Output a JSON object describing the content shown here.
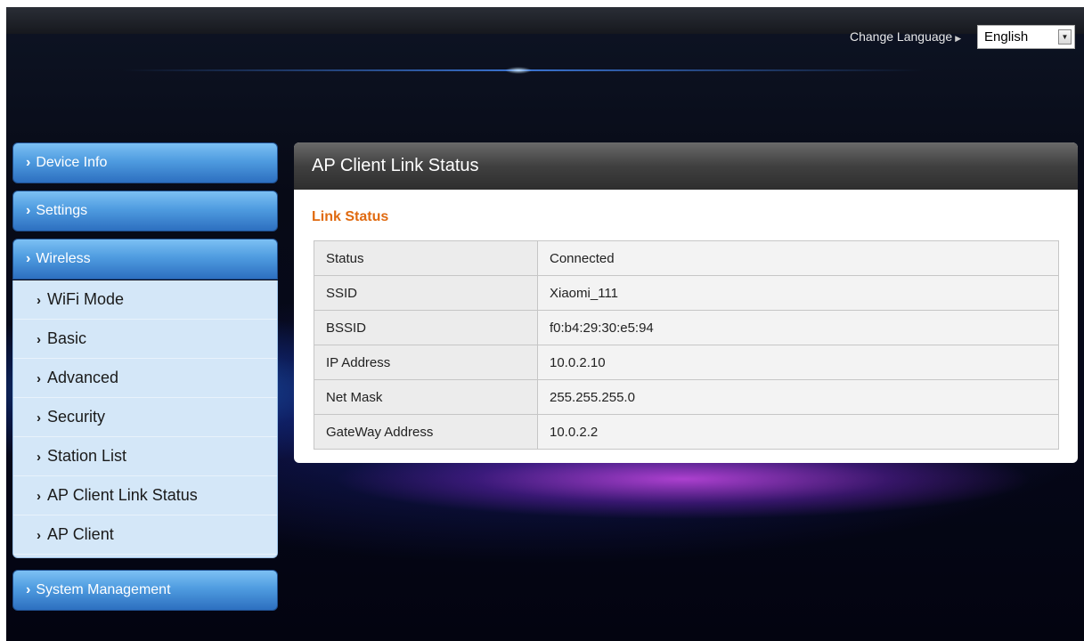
{
  "header": {
    "change_language_label": "Change Language",
    "language_selected": "English"
  },
  "sidebar": {
    "device_info": "Device Info",
    "settings": "Settings",
    "wireless": "Wireless",
    "wireless_items": [
      "WiFi Mode",
      "Basic",
      "Advanced",
      "Security",
      "Station List",
      "AP Client Link Status",
      "AP Client"
    ],
    "system_management": "System Management"
  },
  "main": {
    "title": "AP Client Link Status",
    "section_title": "Link Status",
    "rows": [
      {
        "label": "Status",
        "value": "Connected"
      },
      {
        "label": "SSID",
        "value": "Xiaomi_111"
      },
      {
        "label": "BSSID",
        "value": "f0:b4:29:30:e5:94"
      },
      {
        "label": "IP Address",
        "value": "10.0.2.10"
      },
      {
        "label": "Net Mask",
        "value": "255.255.255.0"
      },
      {
        "label": "GateWay Address",
        "value": "10.0.2.2"
      }
    ]
  },
  "icons": {
    "chevron": "chevron-right-icon",
    "dropdown": "chevron-down-icon"
  },
  "colors": {
    "section_title": "#e06a10",
    "nav_blue": "#4f9ce0",
    "submenu_bg": "#d4e7f8",
    "panel_header": "#404040"
  }
}
